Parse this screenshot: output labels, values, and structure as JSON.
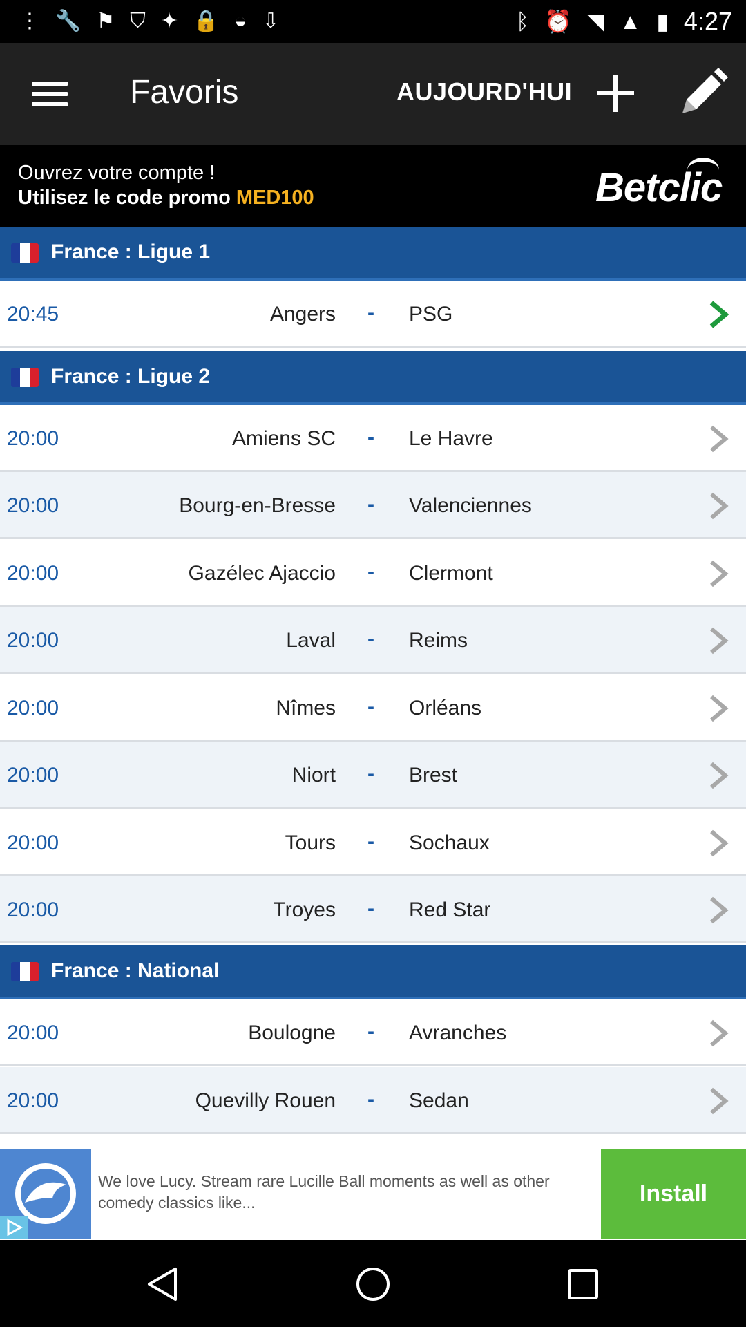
{
  "status_bar": {
    "time": "4:27",
    "left_icons": [
      "menu-dots-icon",
      "wrench-icon",
      "flag-icon",
      "shield-icon",
      "satellite-icon",
      "lock-icon",
      "android-icon",
      "download-tray-icon"
    ],
    "right_icons": [
      "bluetooth-icon",
      "alarm-icon",
      "wifi-icon",
      "signal-icon",
      "battery-icon"
    ]
  },
  "app_bar": {
    "title": "Favoris",
    "today_label": "AUJOURD'HUI"
  },
  "promo": {
    "line1": "Ouvrez votre compte !",
    "line2_prefix": "Utilisez le code promo ",
    "code": "MED100",
    "brand": "Betclic"
  },
  "leagues": [
    {
      "name": "France : Ligue 1",
      "matches": [
        {
          "time": "20:45",
          "home": "Angers",
          "sep": "-",
          "away": "PSG",
          "active": true
        }
      ]
    },
    {
      "name": "France : Ligue 2",
      "matches": [
        {
          "time": "20:00",
          "home": "Amiens SC",
          "sep": "-",
          "away": "Le Havre"
        },
        {
          "time": "20:00",
          "home": "Bourg-en-Bresse",
          "sep": "-",
          "away": "Valenciennes"
        },
        {
          "time": "20:00",
          "home": "Gazélec Ajaccio",
          "sep": "-",
          "away": "Clermont"
        },
        {
          "time": "20:00",
          "home": "Laval",
          "sep": "-",
          "away": "Reims"
        },
        {
          "time": "20:00",
          "home": "Nîmes",
          "sep": "-",
          "away": "Orléans"
        },
        {
          "time": "20:00",
          "home": "Niort",
          "sep": "-",
          "away": "Brest"
        },
        {
          "time": "20:00",
          "home": "Tours",
          "sep": "-",
          "away": "Sochaux"
        },
        {
          "time": "20:00",
          "home": "Troyes",
          "sep": "-",
          "away": "Red Star"
        }
      ]
    },
    {
      "name": "France : National",
      "matches": [
        {
          "time": "20:00",
          "home": "Boulogne",
          "sep": "-",
          "away": "Avranches"
        },
        {
          "time": "20:00",
          "home": "Quevilly Rouen",
          "sep": "-",
          "away": "Sedan"
        }
      ]
    }
  ],
  "ad": {
    "text": "We love Lucy. Stream rare Lucille Ball moments as well as other comedy classics like...",
    "cta": "Install"
  },
  "colors": {
    "league_header": "#1a5496",
    "time_text": "#1a5aa6",
    "promo_code": "#f5b120",
    "active_chevron": "#1e9a3c",
    "inactive_chevron": "#a8a8a8",
    "install_button": "#5cbc3c"
  }
}
